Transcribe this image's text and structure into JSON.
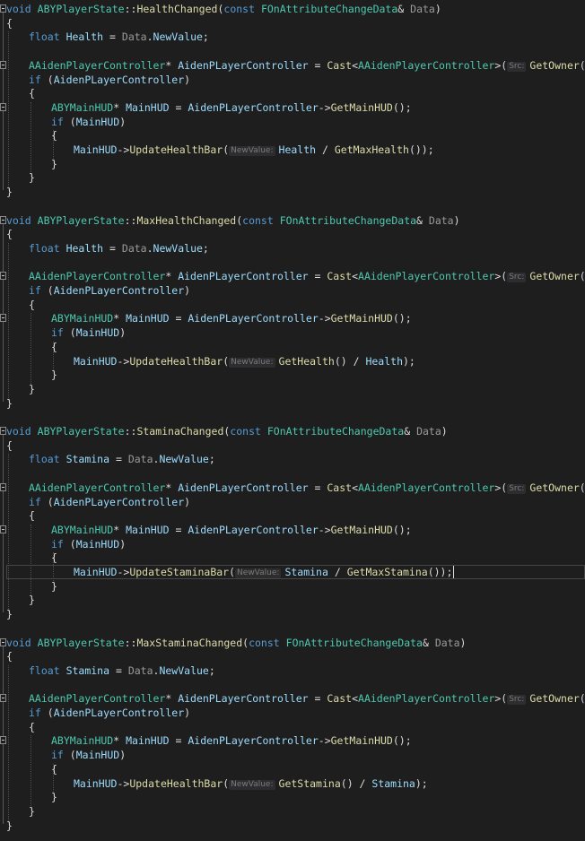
{
  "editor": {
    "functions": [
      {
        "signature": [
          {
            "t": "void",
            "c": "kw"
          },
          {
            "t": " ",
            "c": "plain"
          },
          {
            "t": "ABYPlayerState",
            "c": "type"
          },
          {
            "t": "::",
            "c": "plain"
          },
          {
            "t": "HealthChanged",
            "c": "func"
          },
          {
            "t": "(",
            "c": "plain"
          },
          {
            "t": "const",
            "c": "kw"
          },
          {
            "t": " ",
            "c": "plain"
          },
          {
            "t": "FOnAttributeChangeData",
            "c": "type"
          },
          {
            "t": "& ",
            "c": "plain"
          },
          {
            "t": "Data",
            "c": "param"
          },
          {
            "t": ")",
            "c": "plain"
          }
        ],
        "local_decl": [
          {
            "t": "float",
            "c": "kw"
          },
          {
            "t": " ",
            "c": "plain"
          },
          {
            "t": "Health",
            "c": "local"
          },
          {
            "t": " = ",
            "c": "plain"
          },
          {
            "t": "Data",
            "c": "param"
          },
          {
            "t": ".",
            "c": "plain"
          },
          {
            "t": "NewValue",
            "c": "local"
          },
          {
            "t": ";",
            "c": "plain"
          }
        ],
        "controller_decl": [
          {
            "t": "AAidenPlayerController",
            "c": "type"
          },
          {
            "t": "* ",
            "c": "plain"
          },
          {
            "t": "AidenPLayerController",
            "c": "local"
          },
          {
            "t": " = ",
            "c": "plain"
          },
          {
            "t": "Cast",
            "c": "func"
          },
          {
            "t": "<",
            "c": "plain"
          },
          {
            "t": "AAidenPlayerController",
            "c": "type"
          },
          {
            "t": ">(",
            "c": "plain"
          },
          {
            "hint": "Src:"
          },
          {
            "t": "GetOwner",
            "c": "func"
          },
          {
            "t": "());",
            "c": "plain"
          }
        ],
        "if_controller": [
          {
            "t": "if",
            "c": "kw"
          },
          {
            "t": " (",
            "c": "plain"
          },
          {
            "t": "AidenPLayerController",
            "c": "local"
          },
          {
            "t": ")",
            "c": "plain"
          }
        ],
        "hud_decl": [
          {
            "t": "ABYMainHUD",
            "c": "type"
          },
          {
            "t": "* ",
            "c": "plain"
          },
          {
            "t": "MainHUD",
            "c": "local"
          },
          {
            "t": " = ",
            "c": "plain"
          },
          {
            "t": "AidenPLayerController",
            "c": "local"
          },
          {
            "t": "->",
            "c": "plain"
          },
          {
            "t": "GetMainHUD",
            "c": "func"
          },
          {
            "t": "();",
            "c": "plain"
          }
        ],
        "if_hud": [
          {
            "t": "if",
            "c": "kw"
          },
          {
            "t": " (",
            "c": "plain"
          },
          {
            "t": "MainHUD",
            "c": "local"
          },
          {
            "t": ")",
            "c": "plain"
          }
        ],
        "call": [
          {
            "t": "MainHUD",
            "c": "local"
          },
          {
            "t": "->",
            "c": "plain"
          },
          {
            "t": "UpdateHealthBar",
            "c": "func"
          },
          {
            "t": "(",
            "c": "plain"
          },
          {
            "hint": "NewValue:"
          },
          {
            "t": "Health",
            "c": "local"
          },
          {
            "t": " / ",
            "c": "plain"
          },
          {
            "t": "GetMaxHealth",
            "c": "func"
          },
          {
            "t": "());",
            "c": "plain"
          }
        ]
      },
      {
        "signature": [
          {
            "t": "void",
            "c": "kw"
          },
          {
            "t": " ",
            "c": "plain"
          },
          {
            "t": "ABYPlayerState",
            "c": "type"
          },
          {
            "t": "::",
            "c": "plain"
          },
          {
            "t": "MaxHealthChanged",
            "c": "func"
          },
          {
            "t": "(",
            "c": "plain"
          },
          {
            "t": "const",
            "c": "kw"
          },
          {
            "t": " ",
            "c": "plain"
          },
          {
            "t": "FOnAttributeChangeData",
            "c": "type"
          },
          {
            "t": "& ",
            "c": "plain"
          },
          {
            "t": "Data",
            "c": "param"
          },
          {
            "t": ")",
            "c": "plain"
          }
        ],
        "local_decl": [
          {
            "t": "float",
            "c": "kw"
          },
          {
            "t": " ",
            "c": "plain"
          },
          {
            "t": "Health",
            "c": "local"
          },
          {
            "t": " = ",
            "c": "plain"
          },
          {
            "t": "Data",
            "c": "param"
          },
          {
            "t": ".",
            "c": "plain"
          },
          {
            "t": "NewValue",
            "c": "local"
          },
          {
            "t": ";",
            "c": "plain"
          }
        ],
        "controller_decl": [
          {
            "t": "AAidenPlayerController",
            "c": "type"
          },
          {
            "t": "* ",
            "c": "plain"
          },
          {
            "t": "AidenPLayerController",
            "c": "local"
          },
          {
            "t": " = ",
            "c": "plain"
          },
          {
            "t": "Cast",
            "c": "func"
          },
          {
            "t": "<",
            "c": "plain"
          },
          {
            "t": "AAidenPlayerController",
            "c": "type"
          },
          {
            "t": ">(",
            "c": "plain"
          },
          {
            "hint": "Src:"
          },
          {
            "t": "GetOwner",
            "c": "func"
          },
          {
            "t": "());",
            "c": "plain"
          }
        ],
        "if_controller": [
          {
            "t": "if",
            "c": "kw"
          },
          {
            "t": " (",
            "c": "plain"
          },
          {
            "t": "AidenPLayerController",
            "c": "local"
          },
          {
            "t": ")",
            "c": "plain"
          }
        ],
        "hud_decl": [
          {
            "t": "ABYMainHUD",
            "c": "type"
          },
          {
            "t": "* ",
            "c": "plain"
          },
          {
            "t": "MainHUD",
            "c": "local"
          },
          {
            "t": " = ",
            "c": "plain"
          },
          {
            "t": "AidenPLayerController",
            "c": "local"
          },
          {
            "t": "->",
            "c": "plain"
          },
          {
            "t": "GetMainHUD",
            "c": "func"
          },
          {
            "t": "();",
            "c": "plain"
          }
        ],
        "if_hud": [
          {
            "t": "if",
            "c": "kw"
          },
          {
            "t": " (",
            "c": "plain"
          },
          {
            "t": "MainHUD",
            "c": "local"
          },
          {
            "t": ")",
            "c": "plain"
          }
        ],
        "call": [
          {
            "t": "MainHUD",
            "c": "local"
          },
          {
            "t": "->",
            "c": "plain"
          },
          {
            "t": "UpdateHealthBar",
            "c": "func"
          },
          {
            "t": "(",
            "c": "plain"
          },
          {
            "hint": "NewValue:"
          },
          {
            "t": "GetHealth",
            "c": "func"
          },
          {
            "t": "() / ",
            "c": "plain"
          },
          {
            "t": "Health",
            "c": "local"
          },
          {
            "t": ");",
            "c": "plain"
          }
        ]
      },
      {
        "signature": [
          {
            "t": "void",
            "c": "kw"
          },
          {
            "t": " ",
            "c": "plain"
          },
          {
            "t": "ABYPlayerState",
            "c": "type"
          },
          {
            "t": "::",
            "c": "plain"
          },
          {
            "t": "StaminaChanged",
            "c": "func"
          },
          {
            "t": "(",
            "c": "plain"
          },
          {
            "t": "const",
            "c": "kw"
          },
          {
            "t": " ",
            "c": "plain"
          },
          {
            "t": "FOnAttributeChangeData",
            "c": "type"
          },
          {
            "t": "& ",
            "c": "plain"
          },
          {
            "t": "Data",
            "c": "param"
          },
          {
            "t": ")",
            "c": "plain"
          }
        ],
        "local_decl": [
          {
            "t": "float",
            "c": "kw"
          },
          {
            "t": " ",
            "c": "plain"
          },
          {
            "t": "Stamina",
            "c": "local"
          },
          {
            "t": " = ",
            "c": "plain"
          },
          {
            "t": "Data",
            "c": "param"
          },
          {
            "t": ".",
            "c": "plain"
          },
          {
            "t": "NewValue",
            "c": "local"
          },
          {
            "t": ";",
            "c": "plain"
          }
        ],
        "controller_decl": [
          {
            "t": "AAidenPlayerController",
            "c": "type"
          },
          {
            "t": "* ",
            "c": "plain"
          },
          {
            "t": "AidenPLayerController",
            "c": "local"
          },
          {
            "t": " = ",
            "c": "plain"
          },
          {
            "t": "Cast",
            "c": "func"
          },
          {
            "t": "<",
            "c": "plain"
          },
          {
            "t": "AAidenPlayerController",
            "c": "type"
          },
          {
            "t": ">(",
            "c": "plain"
          },
          {
            "hint": "Src:"
          },
          {
            "t": "GetOwner",
            "c": "func"
          },
          {
            "t": "());",
            "c": "plain"
          }
        ],
        "if_controller": [
          {
            "t": "if",
            "c": "kw"
          },
          {
            "t": " (",
            "c": "plain"
          },
          {
            "t": "AidenPLayerController",
            "c": "local"
          },
          {
            "t": ")",
            "c": "plain"
          }
        ],
        "hud_decl": [
          {
            "t": "ABYMainHUD",
            "c": "type"
          },
          {
            "t": "* ",
            "c": "plain"
          },
          {
            "t": "MainHUD",
            "c": "local"
          },
          {
            "t": " = ",
            "c": "plain"
          },
          {
            "t": "AidenPLayerController",
            "c": "local"
          },
          {
            "t": "->",
            "c": "plain"
          },
          {
            "t": "GetMainHUD",
            "c": "func"
          },
          {
            "t": "();",
            "c": "plain"
          }
        ],
        "if_hud": [
          {
            "t": "if",
            "c": "kw"
          },
          {
            "t": " (",
            "c": "plain"
          },
          {
            "t": "MainHUD",
            "c": "local"
          },
          {
            "t": ")",
            "c": "plain"
          }
        ],
        "call": [
          {
            "t": "MainHUD",
            "c": "local"
          },
          {
            "t": "->",
            "c": "plain"
          },
          {
            "t": "UpdateStaminaBar",
            "c": "func"
          },
          {
            "t": "(",
            "c": "plain"
          },
          {
            "hint": "NewValue:"
          },
          {
            "t": "Stamina",
            "c": "local"
          },
          {
            "t": " / ",
            "c": "plain"
          },
          {
            "t": "GetMaxStamina",
            "c": "func"
          },
          {
            "t": "());",
            "c": "plain"
          }
        ],
        "current_line": true
      },
      {
        "signature": [
          {
            "t": "void",
            "c": "kw"
          },
          {
            "t": " ",
            "c": "plain"
          },
          {
            "t": "ABYPlayerState",
            "c": "type"
          },
          {
            "t": "::",
            "c": "plain"
          },
          {
            "t": "MaxStaminaChanged",
            "c": "func"
          },
          {
            "t": "(",
            "c": "plain"
          },
          {
            "t": "const",
            "c": "kw"
          },
          {
            "t": " ",
            "c": "plain"
          },
          {
            "t": "FOnAttributeChangeData",
            "c": "type"
          },
          {
            "t": "& ",
            "c": "plain"
          },
          {
            "t": "Data",
            "c": "param"
          },
          {
            "t": ")",
            "c": "plain"
          }
        ],
        "local_decl": [
          {
            "t": "float",
            "c": "kw"
          },
          {
            "t": " ",
            "c": "plain"
          },
          {
            "t": "Stamina",
            "c": "local"
          },
          {
            "t": " = ",
            "c": "plain"
          },
          {
            "t": "Data",
            "c": "param"
          },
          {
            "t": ".",
            "c": "plain"
          },
          {
            "t": "NewValue",
            "c": "local"
          },
          {
            "t": ";",
            "c": "plain"
          }
        ],
        "controller_decl": [
          {
            "t": "AAidenPlayerController",
            "c": "type"
          },
          {
            "t": "* ",
            "c": "plain"
          },
          {
            "t": "AidenPLayerController",
            "c": "local"
          },
          {
            "t": " = ",
            "c": "plain"
          },
          {
            "t": "Cast",
            "c": "func"
          },
          {
            "t": "<",
            "c": "plain"
          },
          {
            "t": "AAidenPlayerController",
            "c": "type"
          },
          {
            "t": ">(",
            "c": "plain"
          },
          {
            "hint": "Src:"
          },
          {
            "t": "GetOwner",
            "c": "func"
          },
          {
            "t": "());",
            "c": "plain"
          }
        ],
        "if_controller": [
          {
            "t": "if",
            "c": "kw"
          },
          {
            "t": " (",
            "c": "plain"
          },
          {
            "t": "AidenPLayerController",
            "c": "local"
          },
          {
            "t": ")",
            "c": "plain"
          }
        ],
        "hud_decl": [
          {
            "t": "ABYMainHUD",
            "c": "type"
          },
          {
            "t": "* ",
            "c": "plain"
          },
          {
            "t": "MainHUD",
            "c": "local"
          },
          {
            "t": " = ",
            "c": "plain"
          },
          {
            "t": "AidenPLayerController",
            "c": "local"
          },
          {
            "t": "->",
            "c": "plain"
          },
          {
            "t": "GetMainHUD",
            "c": "func"
          },
          {
            "t": "();",
            "c": "plain"
          }
        ],
        "if_hud": [
          {
            "t": "if",
            "c": "kw"
          },
          {
            "t": " (",
            "c": "plain"
          },
          {
            "t": "MainHUD",
            "c": "local"
          },
          {
            "t": ")",
            "c": "plain"
          }
        ],
        "call": [
          {
            "t": "MainHUD",
            "c": "local"
          },
          {
            "t": "->",
            "c": "plain"
          },
          {
            "t": "UpdateHealthBar",
            "c": "func"
          },
          {
            "t": "(",
            "c": "plain"
          },
          {
            "hint": "NewValue:"
          },
          {
            "t": "GetStamina",
            "c": "func"
          },
          {
            "t": "() / ",
            "c": "plain"
          },
          {
            "t": "Stamina",
            "c": "local"
          },
          {
            "t": ");",
            "c": "plain"
          }
        ]
      }
    ],
    "syntax_colors": {
      "keyword": "#569cd6",
      "type": "#4ec9b0",
      "function": "#dcdcaa",
      "parameter": "#9a9a9a",
      "local": "#9cdcfe",
      "plain": "#dcdcdc",
      "background": "#1e1e1e"
    },
    "icons": [
      "fold-collapse-icon"
    ]
  }
}
